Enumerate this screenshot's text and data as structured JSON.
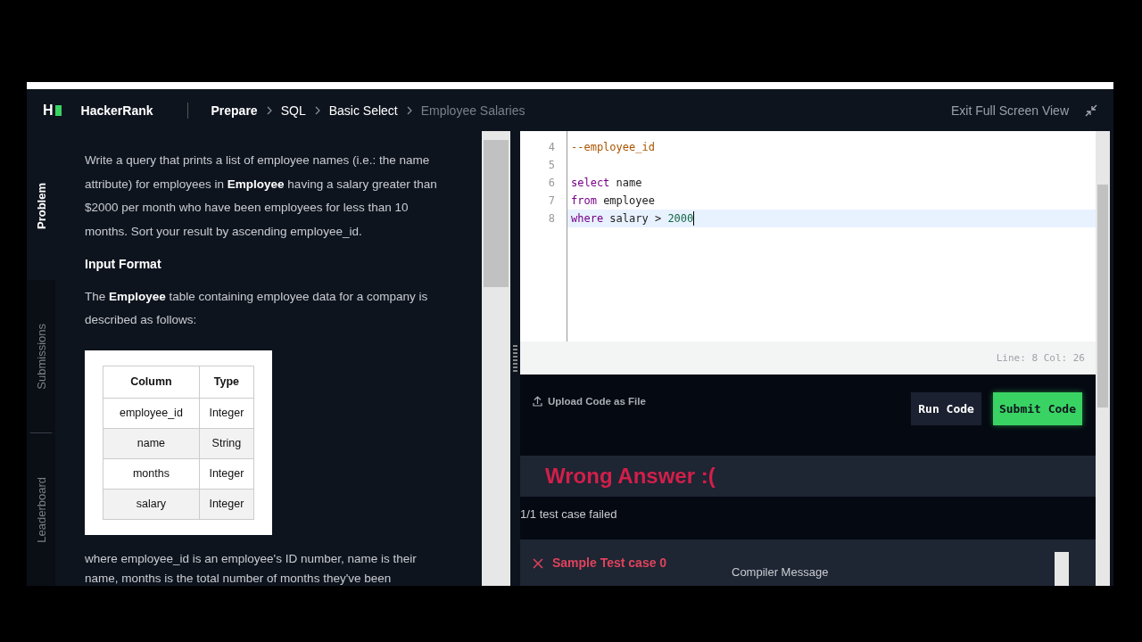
{
  "header": {
    "logo_letter": "H",
    "brand": "HackerRank",
    "breadcrumb": [
      {
        "label": "Prepare",
        "kind": "section"
      },
      {
        "label": "SQL",
        "kind": "link"
      },
      {
        "label": "Basic Select",
        "kind": "link"
      },
      {
        "label": "Employee Salaries",
        "kind": "current"
      }
    ],
    "exit_label": "Exit Full Screen View"
  },
  "side_tabs": [
    {
      "label": "Problem",
      "selected": true
    },
    {
      "label": "Submissions",
      "selected": false
    },
    {
      "label": "Leaderboard",
      "selected": false
    }
  ],
  "problem": {
    "statement": "Write a query that prints a list of employee names (i.e.: the name attribute) for employees in **Employee** having a salary greater than $2000 per month who have been employees for less than 10 months. Sort your result by ascending employee_id.",
    "input_heading": "Input Format",
    "input_text": "The **Employee** table containing employee data for a company is described as follows:",
    "table": {
      "columns": [
        "Column",
        "Type"
      ],
      "rows": [
        [
          "employee_id",
          "Integer"
        ],
        [
          "name",
          "String"
        ],
        [
          "months",
          "Integer"
        ],
        [
          "salary",
          "Integer"
        ]
      ]
    },
    "after_text": "where employee_id is an employee's ID number, name is their name, months is the total number of months they've been"
  },
  "editor": {
    "lines": [
      {
        "number": "4",
        "active": false,
        "tokens": [
          {
            "text": "--employee_id",
            "kind": "comment"
          }
        ]
      },
      {
        "number": "5",
        "active": false
      },
      {
        "number": "6",
        "active": false,
        "tokens": [
          {
            "text": "select",
            "kind": "keyword"
          },
          {
            "text": " name",
            "kind": "plain"
          }
        ]
      },
      {
        "number": "7",
        "active": false,
        "tokens": [
          {
            "text": "from",
            "kind": "keyword"
          },
          {
            "text": " employee",
            "kind": "plain"
          }
        ]
      },
      {
        "number": "8",
        "active": true,
        "tokens": [
          {
            "text": "where",
            "kind": "keyword"
          },
          {
            "text": " salary > ",
            "kind": "plain"
          },
          {
            "text": "2000",
            "kind": "number"
          }
        ]
      }
    ],
    "status": "Line: 8 Col: 26"
  },
  "actions": {
    "upload_label": "Upload Code as File",
    "run_label": "Run Code",
    "submit_label": "Submit Code"
  },
  "result": {
    "title": "Wrong Answer :(",
    "summary": "1/1 test case failed",
    "test_cases": [
      {
        "label": "Sample Test case 0",
        "passed": false
      }
    ],
    "compiler_label": "Compiler Message"
  }
}
